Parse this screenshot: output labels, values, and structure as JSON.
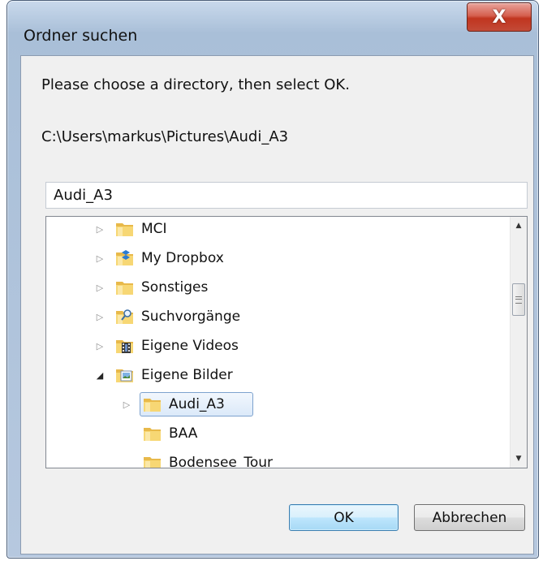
{
  "window": {
    "title": "Ordner suchen",
    "close_label": "X"
  },
  "dialog": {
    "instruction": "Please choose a directory, then select OK.",
    "path": "C:\\Users\\markus\\Pictures\\Audi_A3",
    "folder_value": "Audi_A3"
  },
  "tree": {
    "items": [
      {
        "label": "MCI",
        "icon": "folder-icon",
        "expanded": false,
        "level": 1
      },
      {
        "label": "My Dropbox",
        "icon": "dropbox-folder-icon",
        "expanded": false,
        "level": 1
      },
      {
        "label": "Sonstiges",
        "icon": "folder-icon",
        "expanded": false,
        "level": 1
      },
      {
        "label": "Suchvorgänge",
        "icon": "searches-folder-icon",
        "expanded": false,
        "level": 1
      },
      {
        "label": "Eigene Videos",
        "icon": "videos-folder-icon",
        "expanded": false,
        "level": 1
      },
      {
        "label": "Eigene Bilder",
        "icon": "pictures-folder-icon",
        "expanded": true,
        "level": 1
      },
      {
        "label": "Audi_A3",
        "icon": "folder-icon",
        "expanded": false,
        "level": 2,
        "selected": true
      },
      {
        "label": "BAA",
        "icon": "folder-icon",
        "expanded": null,
        "level": 2
      },
      {
        "label": "Bodensee_Tour",
        "icon": "folder-icon",
        "expanded": null,
        "level": 2
      }
    ]
  },
  "buttons": {
    "ok": "OK",
    "cancel": "Abbrechen"
  },
  "colors": {
    "selection_border": "#7da2ce",
    "close_button": "#c1351f",
    "folder_yellow": "#f5d36b"
  }
}
